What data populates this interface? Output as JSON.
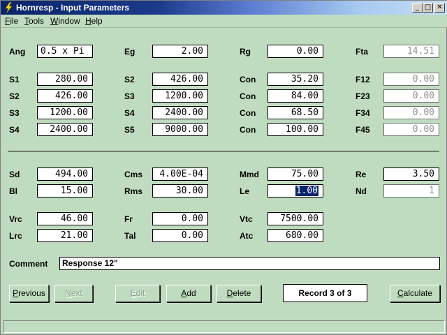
{
  "window": {
    "title": "Hornresp - Input Parameters"
  },
  "titlebar_buttons": {
    "minimize": "_",
    "maximize": "□",
    "close": "✕"
  },
  "menu": [
    "File",
    "Tools",
    "Window",
    "Help"
  ],
  "row0": [
    {
      "label": "Ang",
      "value": "0.5 x Pi",
      "align": "left"
    },
    {
      "label": "Eg",
      "value": "2.00"
    },
    {
      "label": "Rg",
      "value": "0.00"
    },
    {
      "label": "Fta",
      "value": "14.51",
      "readonly": true
    }
  ],
  "block1": [
    [
      {
        "label": "S1",
        "value": "280.00"
      },
      {
        "label": "S2",
        "value": "426.00"
      },
      {
        "label": "Con",
        "value": "35.20"
      },
      {
        "label": "F12",
        "value": "0.00",
        "readonly": true
      }
    ],
    [
      {
        "label": "S2",
        "value": "426.00"
      },
      {
        "label": "S3",
        "value": "1200.00"
      },
      {
        "label": "Con",
        "value": "84.00"
      },
      {
        "label": "F23",
        "value": "0.00",
        "readonly": true
      }
    ],
    [
      {
        "label": "S3",
        "value": "1200.00"
      },
      {
        "label": "S4",
        "value": "2400.00"
      },
      {
        "label": "Con",
        "value": "68.50"
      },
      {
        "label": "F34",
        "value": "0.00",
        "readonly": true
      }
    ],
    [
      {
        "label": "S4",
        "value": "2400.00"
      },
      {
        "label": "S5",
        "value": "9000.00"
      },
      {
        "label": "Con",
        "value": "100.00"
      },
      {
        "label": "F45",
        "value": "0.00",
        "readonly": true
      }
    ]
  ],
  "block2": [
    [
      {
        "label": "Sd",
        "value": "494.00"
      },
      {
        "label": "Cms",
        "value": "4.00E-04"
      },
      {
        "label": "Mmd",
        "value": "75.00"
      },
      {
        "label": "Re",
        "value": "3.50"
      }
    ],
    [
      {
        "label": "Bl",
        "value": "15.00"
      },
      {
        "label": "Rms",
        "value": "30.00"
      },
      {
        "label": "Le",
        "value": "1.00",
        "selected": true
      },
      {
        "label": "Nd",
        "value": "1",
        "readonly": true
      }
    ]
  ],
  "block3": [
    [
      {
        "label": "Vrc",
        "value": "46.00"
      },
      {
        "label": "Fr",
        "value": "0.00"
      },
      {
        "label": "Vtc",
        "value": "7500.00"
      }
    ],
    [
      {
        "label": "Lrc",
        "value": "21.00"
      },
      {
        "label": "Tal",
        "value": "0.00"
      },
      {
        "label": "Atc",
        "value": "680.00"
      }
    ]
  ],
  "comment": {
    "label": "Comment",
    "value": "Response 12\""
  },
  "buttons": [
    {
      "label": "Previous",
      "enabled": true
    },
    {
      "label": "Next",
      "enabled": false
    },
    {
      "label": "Edit",
      "enabled": false
    },
    {
      "label": "Add",
      "enabled": true
    },
    {
      "label": "Delete",
      "enabled": true
    },
    {
      "label": "Calculate",
      "enabled": true
    }
  ],
  "record": "Record 3 of 3"
}
